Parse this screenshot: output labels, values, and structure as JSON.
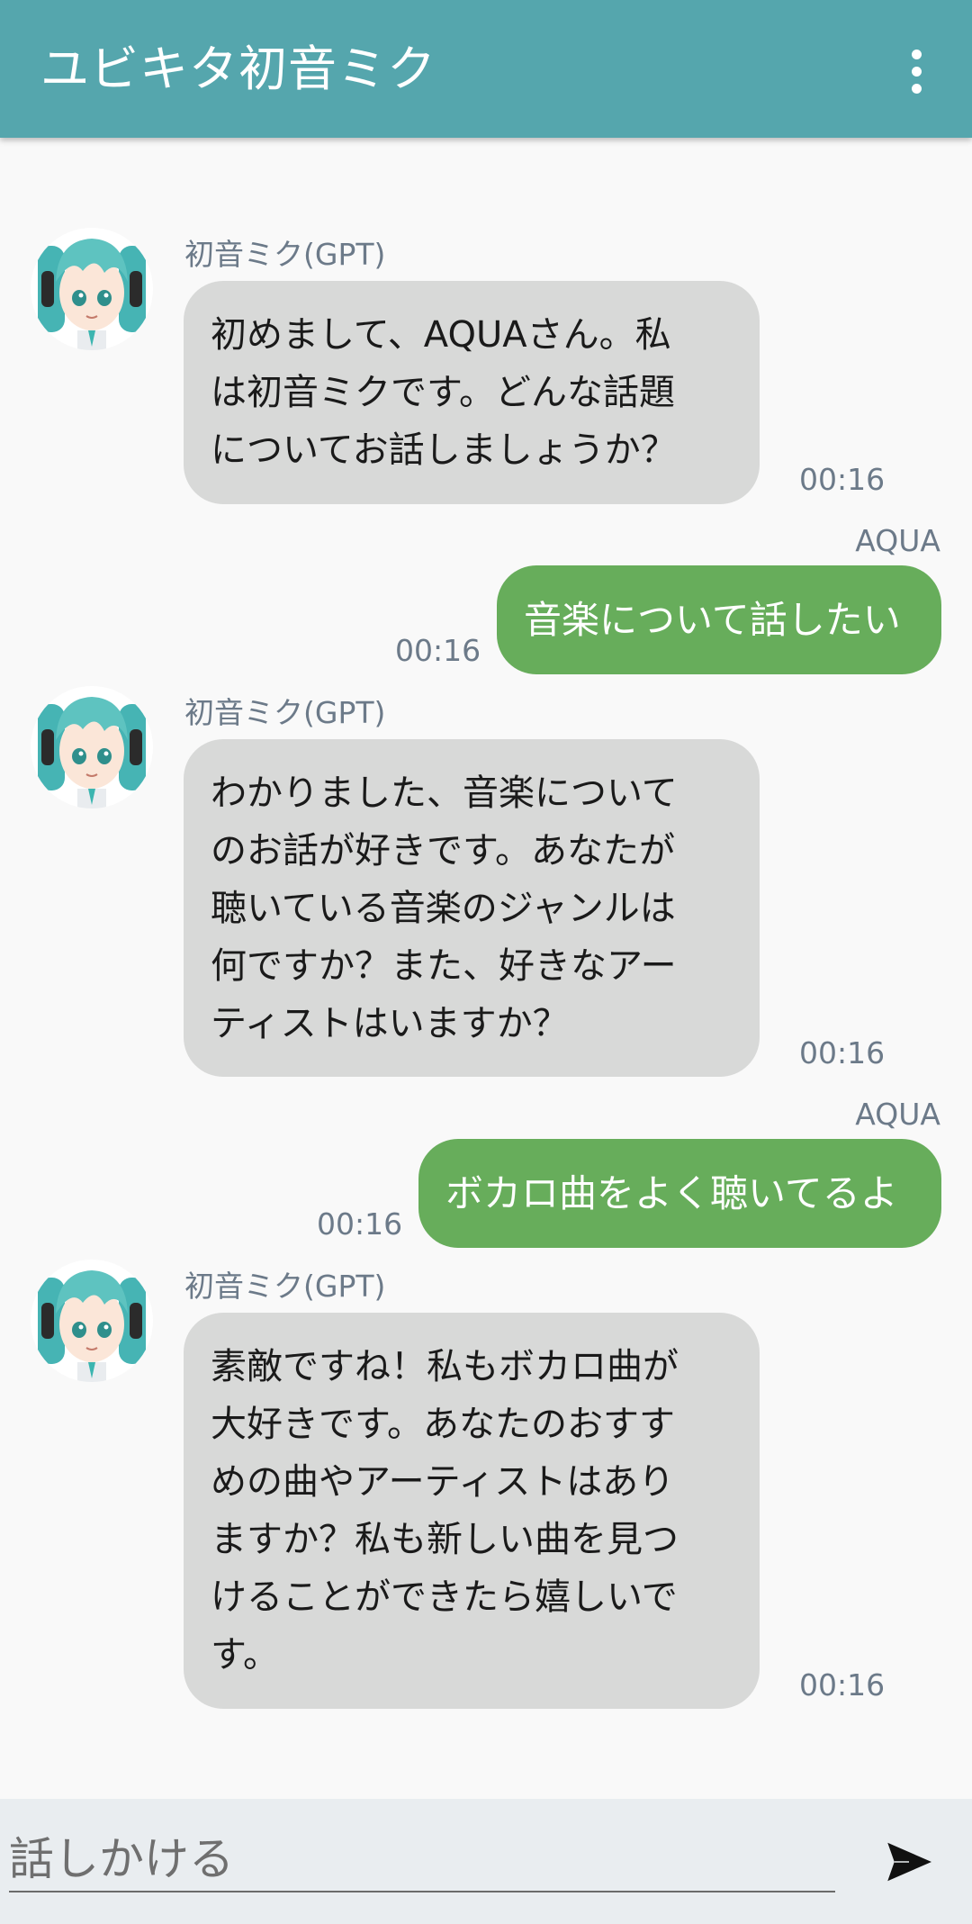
{
  "header": {
    "title": "ユビキタ初音ミク"
  },
  "messages": [
    {
      "from": "bot",
      "sender": "初音ミク(GPT)",
      "text": "初めまして、AQUAさん。私\nは初音ミクです。どんな話題\nについてお話しましょうか？",
      "time": "00:16"
    },
    {
      "from": "me",
      "sender": "AQUA",
      "text": "音楽について話したい",
      "time": "00:16"
    },
    {
      "from": "bot",
      "sender": "初音ミク(GPT)",
      "text": "わかりました、音楽について\nのお話が好きです。あなたが\n聴いている音楽のジャンルは\n何ですか？また、好きなアー\nティストはいますか？",
      "time": "00:16"
    },
    {
      "from": "me",
      "sender": "AQUA",
      "text": "ボカロ曲をよく聴いてるよ",
      "time": "00:16"
    },
    {
      "from": "bot",
      "sender": "初音ミク(GPT)",
      "text": "素敵ですね！私もボカロ曲が\n大好きです。あなたのおすす\nめの曲やアーティストはあり\nますか？私も新しい曲を見つ\nけることができたら嬉しいで\nす。",
      "time": "00:16"
    }
  ],
  "input": {
    "placeholder": "話しかける",
    "value": ""
  },
  "colors": {
    "appbar": "#55a6ad",
    "bubble_in": "#d8d9d8",
    "bubble_out": "#67ad5b",
    "meta_text": "#6c7a89",
    "input_bar": "#e9edf0"
  },
  "icons": {
    "menu": "more-vert-icon",
    "send": "send-icon",
    "avatar": "hatsune-miku-avatar"
  }
}
